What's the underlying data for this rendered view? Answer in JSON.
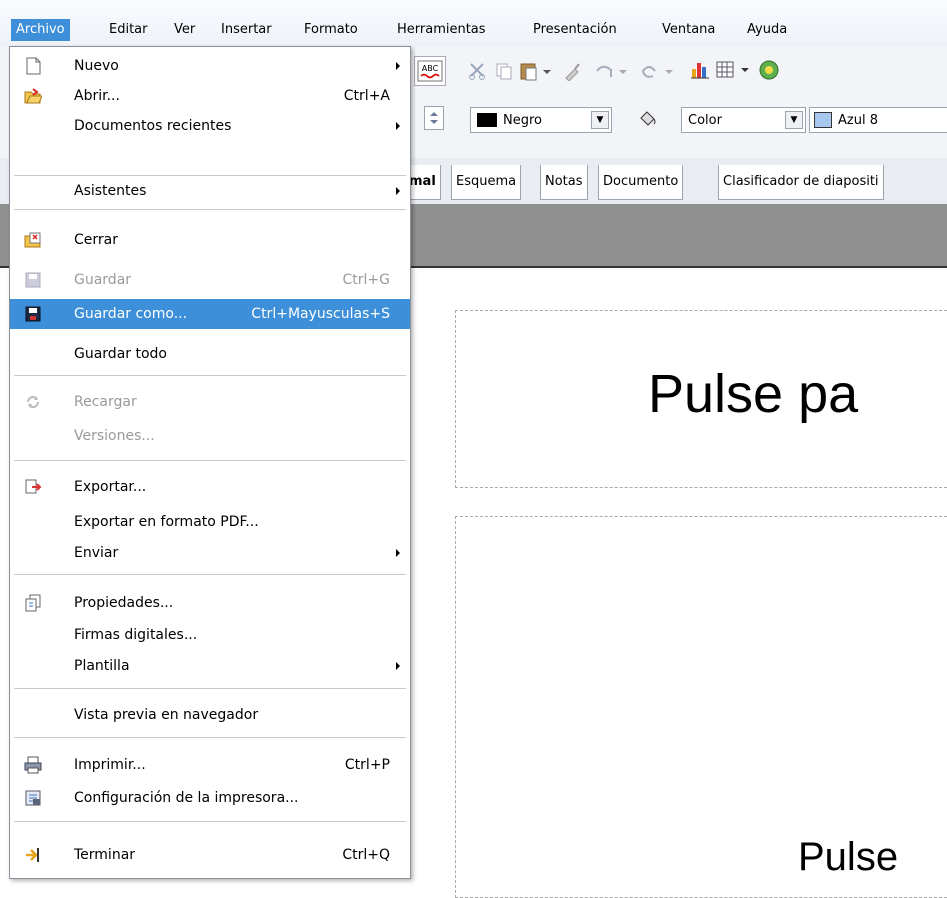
{
  "menubar": {
    "items": [
      {
        "label": "Archivo",
        "active": true
      },
      {
        "label": "Editar"
      },
      {
        "label": "Ver"
      },
      {
        "label": "Insertar"
      },
      {
        "label": "Formato"
      },
      {
        "label": "Herramientas"
      },
      {
        "label": "Presentación"
      },
      {
        "label": "Ventana"
      },
      {
        "label": "Ayuda"
      }
    ]
  },
  "toolbar": {
    "spellcheck_label": "ABC",
    "line_color": "Negro",
    "area_style": "Color",
    "area_color": "Azul 8"
  },
  "tabs": [
    {
      "label": "mal"
    },
    {
      "label": "Esquema"
    },
    {
      "label": "Notas"
    },
    {
      "label": "Documento"
    },
    {
      "label": "Clasificador de diapositi"
    }
  ],
  "slide": {
    "title_text": "Pulse pa",
    "body_text": "Pulse"
  },
  "menu": {
    "items": [
      {
        "label": "Nuevo",
        "icon": "new-document-icon",
        "submenu": true
      },
      {
        "label": "Abrir...",
        "shortcut": "Ctrl+A",
        "icon": "open-folder-icon"
      },
      {
        "label": "Documentos recientes",
        "submenu": true
      },
      {
        "label": "Asistentes",
        "submenu": true
      },
      {
        "label": "Cerrar",
        "icon": "close-document-icon"
      },
      {
        "label": "Guardar",
        "shortcut": "Ctrl+G",
        "icon": "save-icon",
        "disabled": true
      },
      {
        "label": "Guardar como...",
        "shortcut": "Ctrl+Mayusculas+S",
        "icon": "save-as-icon",
        "highlighted": true
      },
      {
        "label": "Guardar todo"
      },
      {
        "label": "Recargar",
        "icon": "reload-icon",
        "disabled": true
      },
      {
        "label": "Versiones...",
        "disabled": true
      },
      {
        "label": "Exportar...",
        "icon": "export-icon"
      },
      {
        "label": "Exportar en formato PDF..."
      },
      {
        "label": "Enviar",
        "submenu": true
      },
      {
        "label": "Propiedades...",
        "icon": "properties-icon"
      },
      {
        "label": "Firmas digitales..."
      },
      {
        "label": "Plantilla",
        "submenu": true
      },
      {
        "label": "Vista previa en navegador"
      },
      {
        "label": "Imprimir...",
        "shortcut": "Ctrl+P",
        "icon": "printer-icon"
      },
      {
        "label": "Configuración de la impresora...",
        "icon": "printer-settings-icon"
      },
      {
        "label": "Terminar",
        "shortcut": "Ctrl+Q",
        "icon": "exit-icon"
      }
    ]
  },
  "colors": {
    "highlight": "#3c8fd8",
    "area_color_swatch": "#a6c8ee",
    "line_color_swatch": "#000000"
  }
}
